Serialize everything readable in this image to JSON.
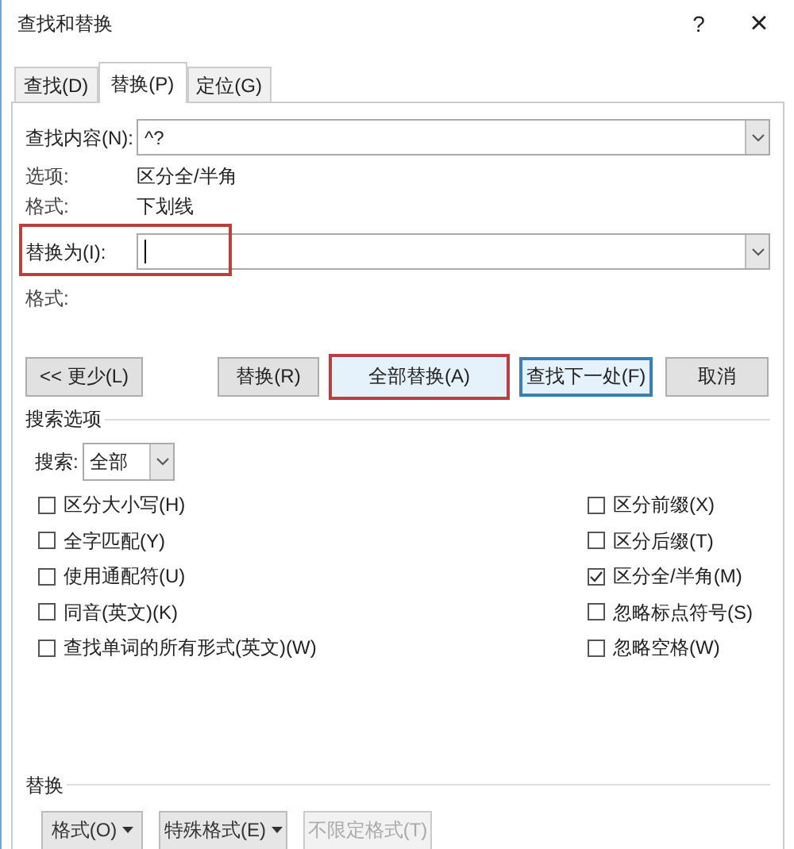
{
  "window": {
    "title": "查找和替换",
    "help": "?",
    "close": "×"
  },
  "tabs": [
    {
      "label": "查找(D)",
      "selected": false
    },
    {
      "label": "替换(P)",
      "selected": true
    },
    {
      "label": "定位(G)",
      "selected": false
    }
  ],
  "find": {
    "label": "查找内容(N):",
    "value": "^?",
    "options_label": "选项:",
    "options_value": "区分全/半角",
    "format_label": "格式:",
    "format_value": "下划线"
  },
  "replace": {
    "label": "替换为(I):",
    "focused": true,
    "highlighted": true,
    "format_label": "格式:"
  },
  "buttons": [
    {
      "label": "<< 更少(L)",
      "kind": "plain",
      "highlighted": false
    },
    {
      "label": "替换(R)",
      "kind": "plain",
      "highlighted": false
    },
    {
      "label": "全部替换(A)",
      "kind": "plain",
      "highlighted": true
    },
    {
      "label": "查找下一处(F)",
      "kind": "default",
      "highlighted": false
    },
    {
      "label": "取消",
      "kind": "plain",
      "highlighted": false
    }
  ],
  "search_options": {
    "title": "搜索选项",
    "search_label": "搜索:",
    "search_value": "全部"
  },
  "options_left": [
    {
      "label": "区分大小写(H)",
      "checked": false
    },
    {
      "label": "全字匹配(Y)",
      "checked": false
    },
    {
      "label": "使用通配符(U)",
      "checked": false
    },
    {
      "label": "同音(英文)(K)",
      "checked": false
    },
    {
      "label": "查找单词的所有形式(英文)(W)",
      "checked": false
    }
  ],
  "options_right": [
    {
      "label": "区分前缀(X)",
      "checked": false
    },
    {
      "label": "区分后缀(T)",
      "checked": false
    },
    {
      "label": "区分全/半角(M)",
      "checked": true
    },
    {
      "label": "忽略标点符号(S)",
      "checked": false
    },
    {
      "label": "忽略空格(W)",
      "checked": false
    }
  ],
  "replace_section": {
    "title": "替换",
    "buttons": [
      {
        "label": "格式(O)",
        "menu": true,
        "disabled": false
      },
      {
        "label": "特殊格式(E)",
        "menu": true,
        "disabled": false
      },
      {
        "label": "不限定格式(T)",
        "menu": false,
        "disabled": true
      }
    ]
  }
}
